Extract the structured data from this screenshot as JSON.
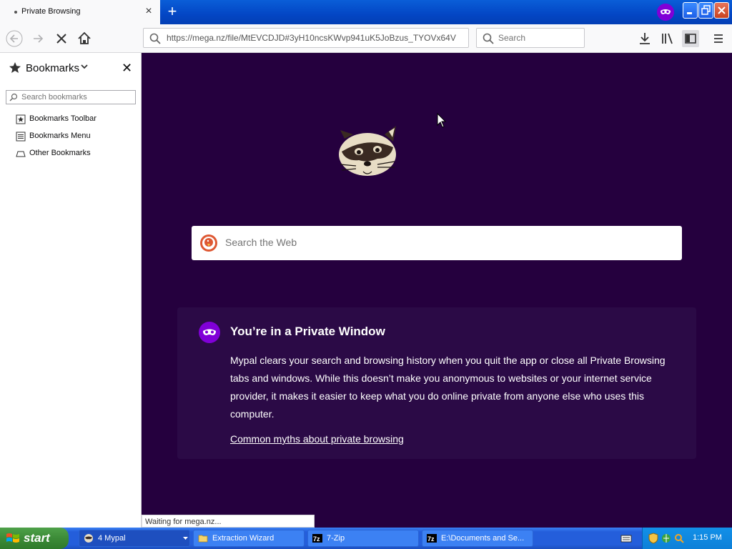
{
  "browser": {
    "tab_title": "Private Browsing",
    "tab_close": "×",
    "new_tab": "+",
    "url": "https://mega.nz/file/MtEVCDJD#3yH10ncsKWvp941uK5JoBzus_TYOVx64V",
    "search_placeholder": "Search",
    "status": "Waiting for mega.nz..."
  },
  "sidebar": {
    "title": "Bookmarks",
    "close": "✕",
    "search_placeholder": "Search bookmarks",
    "items": [
      {
        "label": "Bookmarks Toolbar"
      },
      {
        "label": "Bookmarks Menu"
      },
      {
        "label": "Other Bookmarks"
      }
    ]
  },
  "content": {
    "web_search_placeholder": "Search the Web",
    "private_title": "You’re in a Private Window",
    "private_body": "Mypal clears your search and browsing history when you quit the app or close all Private Browsing tabs and windows. While this doesn’t make you anonymous to websites or your internet service provider, it makes it easier to keep what you do online private from anyone else who uses this computer.",
    "private_link": "Common myths about private browsing"
  },
  "taskbar": {
    "start_label": "start",
    "tasks": [
      {
        "label": "4 Mypal"
      },
      {
        "label": "Extraction Wizard"
      },
      {
        "label": "7-Zip"
      },
      {
        "label": "E:\\Documents and Se..."
      }
    ],
    "clock": "1:15 PM"
  },
  "colors": {
    "content_bg": "#25003e",
    "private_accent": "#8000d7",
    "taskbar_blue": "#245edb",
    "start_green": "#3c8b37"
  }
}
